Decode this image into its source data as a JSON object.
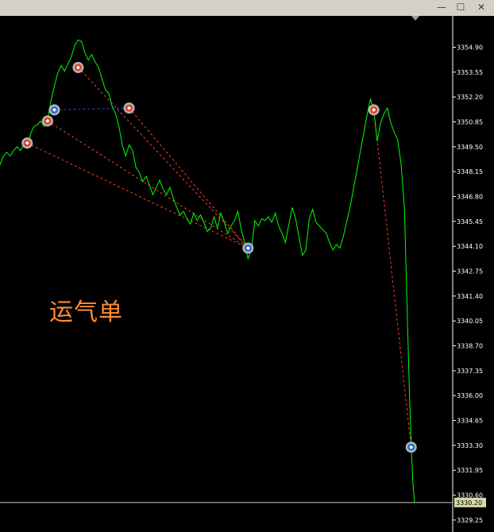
{
  "window": {
    "minimize_icon": "minimize-icon",
    "maximize_icon": "maximize-icon",
    "close_icon": "close-icon"
  },
  "annotation_text": "运气单",
  "colors": {
    "background": "#000000",
    "price_line": "#00ff00",
    "axis": "#ffffff",
    "sell_marker": "#e04020",
    "buy_marker": "#1e6fd8",
    "sell_trade_line": "#ff3c28",
    "buy_trade_line": "#2050ff",
    "current_price_label_bg": "#d8d8a8",
    "annotation": "#ff8c3a"
  },
  "chart_data": {
    "type": "line",
    "title": "",
    "xlabel": "",
    "ylabel": "",
    "ylim": [
      3328.6,
      3356.6
    ],
    "yticks": [
      "3354.90",
      "3353.55",
      "3352.20",
      "3350.85",
      "3349.50",
      "3348.15",
      "3346.80",
      "3345.45",
      "3344.10",
      "3342.75",
      "3341.40",
      "3340.05",
      "3338.70",
      "3337.35",
      "3336.00",
      "3334.65",
      "3333.30",
      "3331.95",
      "3330.60",
      "3329.25"
    ],
    "current_price": "3330.20",
    "xlim": [
      0,
      122
    ],
    "grid": false,
    "series": [
      {
        "values": [
          [
            0,
            3348.5
          ],
          [
            1,
            3349.0
          ],
          [
            2,
            3349.2
          ],
          [
            3,
            3349.0
          ],
          [
            4,
            3349.3
          ],
          [
            5,
            3349.5
          ],
          [
            6,
            3349.3
          ],
          [
            7,
            3349.6
          ],
          [
            8,
            3349.4
          ],
          [
            9,
            3350.2
          ],
          [
            10,
            3350.6
          ],
          [
            11,
            3350.7
          ],
          [
            12,
            3350.9
          ],
          [
            13,
            3350.6
          ],
          [
            14,
            3351.0
          ],
          [
            15,
            3352.0
          ],
          [
            16,
            3352.8
          ],
          [
            17,
            3353.5
          ],
          [
            18,
            3353.9
          ],
          [
            19,
            3353.6
          ],
          [
            20,
            3354.0
          ],
          [
            21,
            3354.4
          ],
          [
            22,
            3355.0
          ],
          [
            23,
            3355.3
          ],
          [
            24,
            3355.2
          ],
          [
            25,
            3354.6
          ],
          [
            26,
            3354.2
          ],
          [
            27,
            3354.5
          ],
          [
            28,
            3354.1
          ],
          [
            29,
            3353.8
          ],
          [
            30,
            3353.2
          ],
          [
            31,
            3352.6
          ],
          [
            32,
            3352.4
          ],
          [
            33,
            3351.7
          ],
          [
            34,
            3351.3
          ],
          [
            35,
            3350.6
          ],
          [
            36,
            3349.6
          ],
          [
            37,
            3349.0
          ],
          [
            38,
            3349.6
          ],
          [
            39,
            3349.3
          ],
          [
            40,
            3348.4
          ],
          [
            41,
            3348.1
          ],
          [
            42,
            3347.6
          ],
          [
            43,
            3347.9
          ],
          [
            44,
            3347.4
          ],
          [
            45,
            3346.9
          ],
          [
            46,
            3347.3
          ],
          [
            47,
            3347.7
          ],
          [
            48,
            3347.2
          ],
          [
            49,
            3346.9
          ],
          [
            50,
            3347.3
          ],
          [
            51,
            3346.7
          ],
          [
            52,
            3346.2
          ],
          [
            53,
            3345.8
          ],
          [
            54,
            3346.0
          ],
          [
            55,
            3345.6
          ],
          [
            56,
            3345.3
          ],
          [
            57,
            3345.9
          ],
          [
            58,
            3345.5
          ],
          [
            59,
            3345.8
          ],
          [
            60,
            3345.4
          ],
          [
            61,
            3344.9
          ],
          [
            62,
            3345.1
          ],
          [
            63,
            3345.7
          ],
          [
            64,
            3345.1
          ],
          [
            65,
            3345.9
          ],
          [
            66,
            3345.4
          ],
          [
            67,
            3344.8
          ],
          [
            68,
            3345.2
          ],
          [
            69,
            3345.5
          ],
          [
            70,
            3346.0
          ],
          [
            71,
            3345.0
          ],
          [
            72,
            3344.3
          ],
          [
            73,
            3343.4
          ],
          [
            74,
            3344.0
          ],
          [
            75,
            3345.5
          ],
          [
            76,
            3345.2
          ],
          [
            77,
            3345.6
          ],
          [
            78,
            3345.5
          ],
          [
            79,
            3345.7
          ],
          [
            80,
            3345.4
          ],
          [
            81,
            3345.9
          ],
          [
            82,
            3345.2
          ],
          [
            83,
            3344.8
          ],
          [
            84,
            3344.3
          ],
          [
            85,
            3345.3
          ],
          [
            86,
            3346.2
          ],
          [
            87,
            3345.6
          ],
          [
            88,
            3344.6
          ],
          [
            89,
            3343.6
          ],
          [
            90,
            3343.9
          ],
          [
            91,
            3345.6
          ],
          [
            92,
            3346.1
          ],
          [
            93,
            3345.4
          ],
          [
            94,
            3345.2
          ],
          [
            95,
            3345.0
          ],
          [
            96,
            3344.8
          ],
          [
            97,
            3344.3
          ],
          [
            98,
            3343.9
          ],
          [
            99,
            3344.2
          ],
          [
            100,
            3344.0
          ],
          [
            101,
            3344.6
          ],
          [
            102,
            3345.4
          ],
          [
            103,
            3346.2
          ],
          [
            104,
            3347.2
          ],
          [
            105,
            3348.2
          ],
          [
            106,
            3349.2
          ],
          [
            107,
            3350.2
          ],
          [
            108,
            3351.2
          ],
          [
            109,
            3352.1
          ],
          [
            110,
            3351.5
          ],
          [
            111,
            3349.8
          ],
          [
            112,
            3350.8
          ],
          [
            113,
            3351.3
          ],
          [
            114,
            3351.6
          ],
          [
            115,
            3350.8
          ],
          [
            116,
            3350.3
          ],
          [
            117,
            3349.9
          ],
          [
            118,
            3348.6
          ],
          [
            119,
            3346.2
          ],
          [
            120,
            3339.5
          ],
          [
            120.5,
            3336.0
          ],
          [
            121,
            3333.4
          ],
          [
            121.5,
            3331.2
          ],
          [
            122,
            3330.2
          ]
        ]
      }
    ],
    "trades": [
      {
        "open": [
          8,
          3349.7
        ],
        "close": [
          73,
          3344.0
        ],
        "direction": "sell"
      },
      {
        "open": [
          14,
          3350.9
        ],
        "close": [
          73,
          3344.0
        ],
        "direction": "sell"
      },
      {
        "open": [
          16,
          3351.5
        ],
        "close": [
          38,
          3351.6
        ],
        "direction": "buy"
      },
      {
        "open": [
          23,
          3353.8
        ],
        "close": [
          73,
          3344.0
        ],
        "direction": "sell"
      },
      {
        "open": [
          38,
          3351.6
        ],
        "close": [
          73,
          3344.0
        ],
        "direction": "sell"
      },
      {
        "open": [
          110,
          3351.5
        ],
        "close": [
          121,
          3333.2
        ],
        "direction": "sell"
      }
    ]
  }
}
